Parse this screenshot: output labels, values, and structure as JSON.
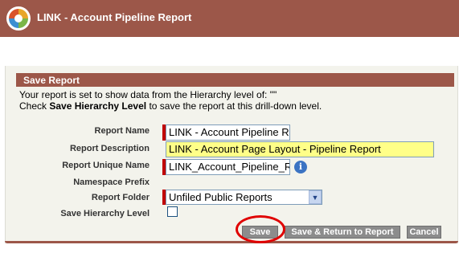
{
  "header": {
    "title": "LINK - Account Pipeline Report"
  },
  "panel": {
    "title": "Save Report",
    "info_line1": "Your report is set to show data from the Hierarchy level of: \"\"",
    "info_line2_prefix": "Check ",
    "info_line2_bold": "Save Hierarchy Level",
    "info_line2_suffix": " to save the report at this drill-down level."
  },
  "form": {
    "report_name_label": "Report Name",
    "report_name_value": "LINK - Account Pipeline R",
    "report_description_label": "Report Description",
    "report_description_value": "LINK - Account Page Layout - Pipeline Report",
    "report_unique_name_label": "Report Unique Name",
    "report_unique_name_value": "LINK_Account_Pipeline_R",
    "namespace_prefix_label": "Namespace Prefix",
    "report_folder_label": "Report Folder",
    "report_folder_value": "Unfiled Public Reports",
    "save_hierarchy_label": "Save Hierarchy Level",
    "save_hierarchy_checked": false
  },
  "buttons": {
    "save": "Save",
    "save_return": "Save & Return to Report",
    "cancel": "Cancel"
  },
  "icons": {
    "logo": "salesforce-cube-icon",
    "info": "info-icon",
    "dropdown": "chevron-down-icon"
  },
  "colors": {
    "header": "#9c5749",
    "required": "#c00000",
    "highlight": "#ffff88",
    "annotation": "#e00000"
  }
}
